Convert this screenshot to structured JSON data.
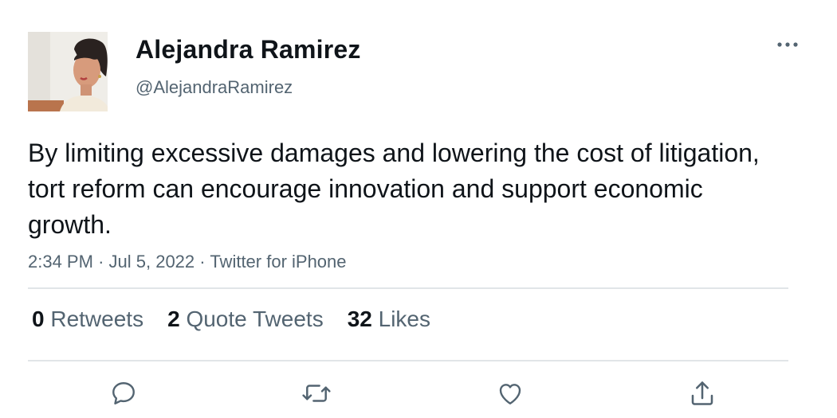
{
  "author": {
    "name": "Alejandra Ramirez",
    "handle": "@AlejandraRamirez"
  },
  "tweet": {
    "text": "By limiting excessive damages and lowering the cost of litigation, tort reform can encourage innovation and support economic growth.",
    "time": "2:34 PM",
    "date": "Jul 5, 2022",
    "source": "Twitter for iPhone",
    "separator": "·"
  },
  "stats": {
    "retweets_count": "0",
    "retweets_label": "Retweets",
    "quotes_count": "2",
    "quotes_label": "Quote Tweets",
    "likes_count": "32",
    "likes_label": "Likes"
  },
  "icons": {
    "more": "more-horizontal-icon",
    "reply": "reply-icon",
    "retweet": "retweet-icon",
    "like": "heart-icon",
    "share": "share-icon"
  },
  "colors": {
    "text": "#0f1419",
    "secondary": "#536471",
    "divider": "#e1e5e8"
  }
}
